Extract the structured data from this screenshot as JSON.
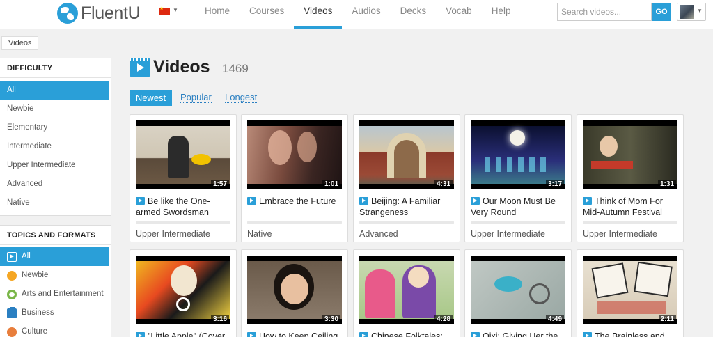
{
  "header": {
    "brand": "FluentU",
    "nav": [
      "Home",
      "Courses",
      "Videos",
      "Audios",
      "Decks",
      "Vocab",
      "Help"
    ],
    "active_nav": "Videos",
    "search_placeholder": "Search videos...",
    "search_button": "GO"
  },
  "breadcrumb": "Videos",
  "difficulty": {
    "heading": "DIFFICULTY",
    "items": [
      "All",
      "Newbie",
      "Elementary",
      "Intermediate",
      "Upper Intermediate",
      "Advanced",
      "Native"
    ]
  },
  "topics": {
    "heading": "TOPICS AND FORMATS",
    "items": [
      {
        "label": "All",
        "icon": "video-icon"
      },
      {
        "label": "Newbie",
        "icon": "smile-icon"
      },
      {
        "label": "Arts and Entertainment",
        "icon": "arts-icon"
      },
      {
        "label": "Business",
        "icon": "briefcase-icon"
      },
      {
        "label": "Culture",
        "icon": "culture-icon"
      }
    ]
  },
  "main": {
    "title": "Videos",
    "count": "1469",
    "sort": [
      "Newest",
      "Popular",
      "Longest"
    ]
  },
  "videos": [
    {
      "title": "Be like the One-armed Swordsman",
      "duration": "1:57",
      "level": "Upper Intermediate"
    },
    {
      "title": "Embrace the Future",
      "duration": "1:01",
      "level": "Native"
    },
    {
      "title": "Beijing: A Familiar Strangeness",
      "duration": "4:31",
      "level": "Advanced"
    },
    {
      "title": "Our Moon Must Be Very Round",
      "duration": "3:17",
      "level": "Upper Intermediate"
    },
    {
      "title": "Think of Mom For Mid-Autumn Festival",
      "duration": "1:31",
      "level": "Upper Intermediate"
    },
    {
      "title": "\"Little Apple\" (Cover",
      "duration": "3:16",
      "level": ""
    },
    {
      "title": "How to Keep Ceiling",
      "duration": "3:30",
      "level": ""
    },
    {
      "title": "Chinese Folktales:",
      "duration": "4:28",
      "level": ""
    },
    {
      "title": "Qixi: Giving Her the",
      "duration": "4:49",
      "level": ""
    },
    {
      "title": "The Brainless and",
      "duration": "2:11",
      "level": ""
    }
  ],
  "colors": {
    "accent": "#2a9fd8",
    "link": "#2a7fc1"
  }
}
